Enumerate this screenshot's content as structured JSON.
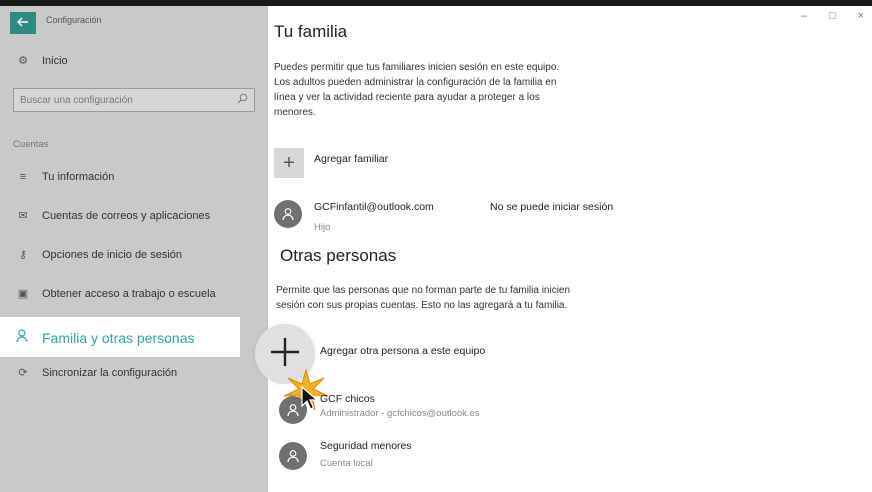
{
  "window": {
    "app_title": "Configuración",
    "minimize": "–",
    "maximize": "□",
    "close": "×"
  },
  "sidebar": {
    "home_label": "Inicio",
    "search_placeholder": "Buscar una configuración",
    "section_label": "Cuentas",
    "items": [
      {
        "label": "Tu información",
        "icon": "id-card-icon"
      },
      {
        "label": "Cuentas de correos y aplicaciones",
        "icon": "mail-icon"
      },
      {
        "label": "Opciones de inicio de sesión",
        "icon": "key-icon"
      },
      {
        "label": "Obtener acceso a trabajo o escuela",
        "icon": "briefcase-icon"
      },
      {
        "label": "Familia y otras personas",
        "icon": "person-icon",
        "selected": true
      },
      {
        "label": "Sincronizar la configuración",
        "icon": "sync-icon"
      }
    ],
    "accent_color": "#2aa3b0"
  },
  "main": {
    "family_title": "Tu familia",
    "family_desc_lines": [
      "Puedes permitir que tus familiares inicien sesión en este equipo.",
      "Los adultos pueden administrar la configuración de la familia en",
      "línea y ver la actividad reciente para ayudar a proteger a los",
      "menores."
    ],
    "add_family_label": "Agregar familiar",
    "family_member": {
      "email": "GCFinfantil@outlook.com",
      "role": "Hijo",
      "status": "No se puede iniciar sesión"
    },
    "others_title": "Otras personas",
    "others_desc_lines": [
      "Permite que las personas que no forman parte de tu familia inicien",
      "sesión con sus propias cuentas. Esto no las agregará a tu familia."
    ],
    "add_other_label": "Agregar otra persona a este equipo",
    "other_accounts": [
      {
        "name": "GCF chicos",
        "detail": "Administrador - gcfchicos@outlook.es"
      },
      {
        "name": "Seguridad menores",
        "detail": "Cuenta local"
      }
    ]
  }
}
